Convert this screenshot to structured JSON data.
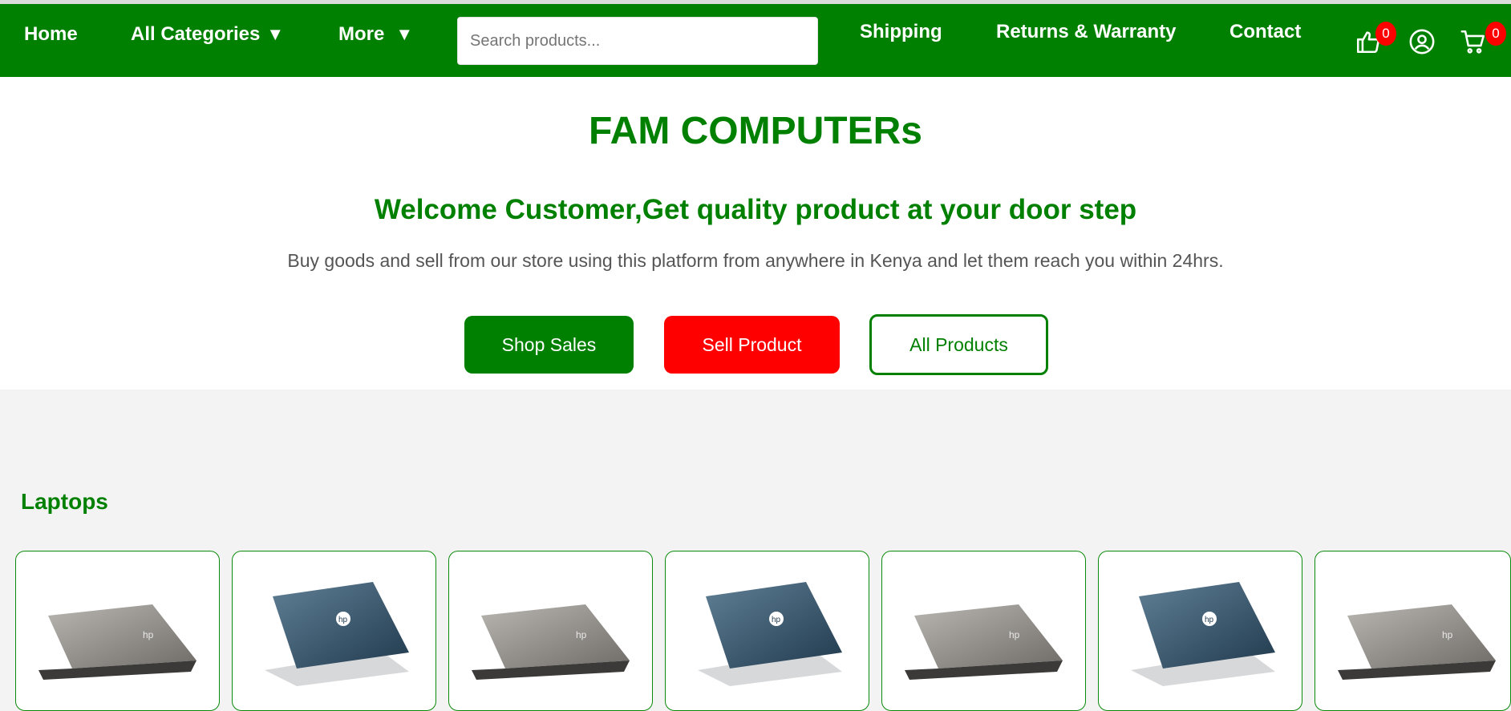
{
  "nav": {
    "home": "Home",
    "all_categories": "All Categories",
    "more": "More",
    "caret": "▼",
    "search_placeholder": "Search products...",
    "shipping": "Shipping",
    "returns": "Returns & Warranty",
    "contact": "Contact",
    "likes_count": "0",
    "cart_count": "0"
  },
  "hero": {
    "brand": "FAM COMPUTERs",
    "welcome": "Welcome Customer,Get quality product at your door step",
    "subtext": "Buy goods and sell from our store using this platform from anywhere in Kenya and let them reach you within 24hrs.",
    "shop_sales": "Shop Sales",
    "sell_product": "Sell Product",
    "all_products": "All Products"
  },
  "section": {
    "title": "Laptops"
  },
  "colors": {
    "brand_green": "#008000",
    "accent_red": "#ff0000"
  },
  "cards": [
    {
      "image": "silver-laptop"
    },
    {
      "image": "blue-laptop"
    },
    {
      "image": "silver-laptop"
    },
    {
      "image": "blue-laptop"
    },
    {
      "image": "silver-laptop"
    },
    {
      "image": "blue-laptop"
    },
    {
      "image": "silver-laptop"
    }
  ]
}
